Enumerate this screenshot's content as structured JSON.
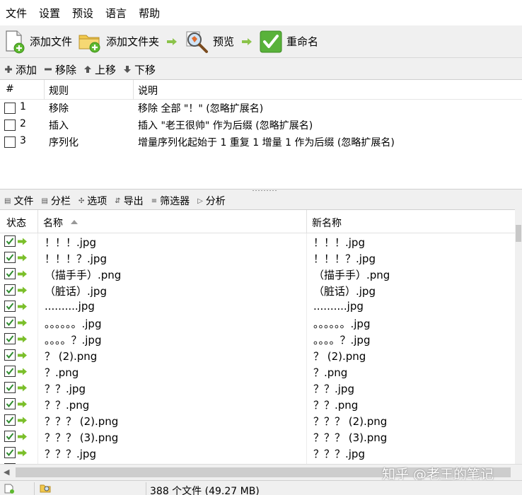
{
  "menu": [
    "文件",
    "设置",
    "预设",
    "语言",
    "帮助"
  ],
  "toolbar": {
    "add_file": "添加文件",
    "add_folder": "添加文件夹",
    "preview": "预览",
    "rename": "重命名"
  },
  "rule_actions": [
    "添加",
    "移除",
    "上移",
    "下移"
  ],
  "rules_table": {
    "headers": [
      "#",
      "规则",
      "说明"
    ],
    "rows": [
      {
        "num": "1",
        "rule": "移除",
        "desc": "移除 全部 \"！\" (忽略扩展名)"
      },
      {
        "num": "2",
        "rule": "插入",
        "desc": "插入 \"老王很帅\" 作为后缀 (忽略扩展名)"
      },
      {
        "num": "3",
        "rule": "序列化",
        "desc": "增量序列化起始于 1 重复 1 增量 1 作为后缀 (忽略扩展名)"
      }
    ]
  },
  "file_tabs": [
    "文件",
    "分栏",
    "选项",
    "导出",
    "筛选器",
    "分析"
  ],
  "file_table": {
    "headers": {
      "status": "状态",
      "name": "名称",
      "new_name": "新名称"
    },
    "rows": [
      {
        "old": "！！！.jpg",
        "new": "！！！.jpg"
      },
      {
        "old": "！！！？.jpg",
        "new": "！！！？.jpg"
      },
      {
        "old": "（描手手）.png",
        "new": "（描手手）.png"
      },
      {
        "old": "（脏话）.jpg",
        "new": "（脏话）.jpg"
      },
      {
        "old": "..........jpg",
        "new": "..........jpg"
      },
      {
        "old": "。。。。。。.jpg",
        "new": "。。。。。。.jpg"
      },
      {
        "old": "。。。。？.jpg",
        "new": "。。。。？.jpg"
      },
      {
        "old": "？ (2).png",
        "new": "？ (2).png"
      },
      {
        "old": "？.png",
        "new": "？.png"
      },
      {
        "old": "？？.jpg",
        "new": "？？.jpg"
      },
      {
        "old": "？？.png",
        "new": "？？.png"
      },
      {
        "old": "？？？ (2).png",
        "new": "？？？ (2).png"
      },
      {
        "old": "？？？ (3).png",
        "new": "？？？ (3).png"
      },
      {
        "old": "？？？.jpg",
        "new": "？？？.jpg"
      },
      {
        "old": "？？？",
        "new": "？？？"
      }
    ]
  },
  "status": {
    "summary": "388 个文件 (49.27 MB)"
  },
  "watermark": "知乎 @老王的笔记",
  "colors": {
    "check_green": "#2e8b2e",
    "arrow_green": "#7bbf2a",
    "rename_green": "#59b23a"
  }
}
